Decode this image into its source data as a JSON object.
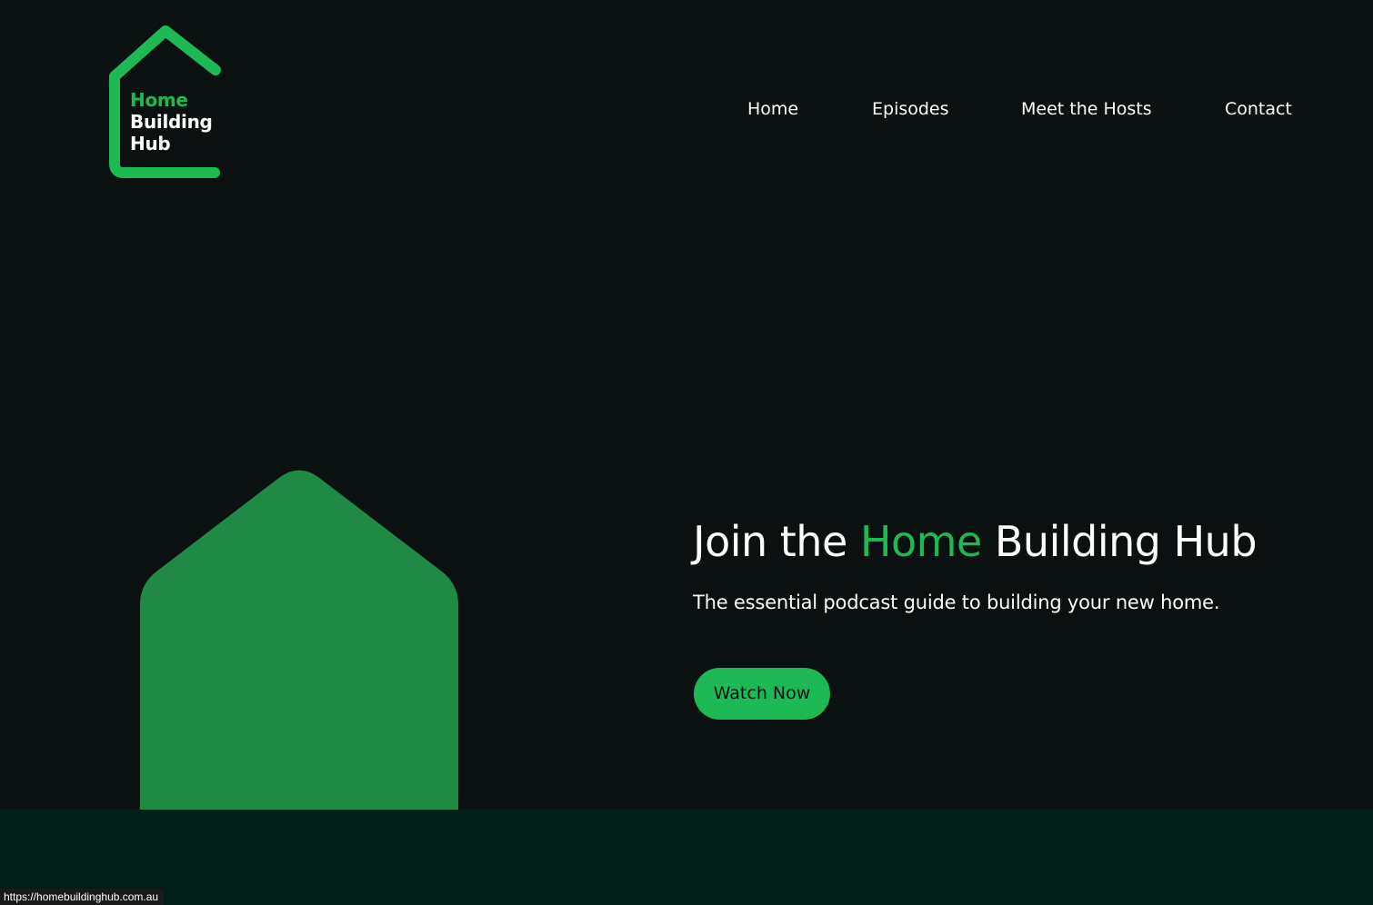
{
  "brand": {
    "name_line1": "Home",
    "name_line2": "Building",
    "name_line3": "Hub",
    "logo_icon": "house-outline-icon",
    "accent_color": "#1db954",
    "background_color": "#0a1110",
    "footer_color": "#001f18",
    "shape_color": "#208945"
  },
  "nav": {
    "items": [
      {
        "label": "Home"
      },
      {
        "label": "Episodes"
      },
      {
        "label": "Meet the Hosts"
      },
      {
        "label": "Contact"
      }
    ]
  },
  "hero": {
    "title_part1": "Join the ",
    "title_accent": "Home",
    "title_part2": " Building Hub",
    "subtitle": "The essential podcast guide to building your new home.",
    "cta_label": "Watch Now",
    "decor_icon": "house-shape-icon"
  },
  "status_bar": {
    "url": "https://homebuildinghub.com.au"
  }
}
